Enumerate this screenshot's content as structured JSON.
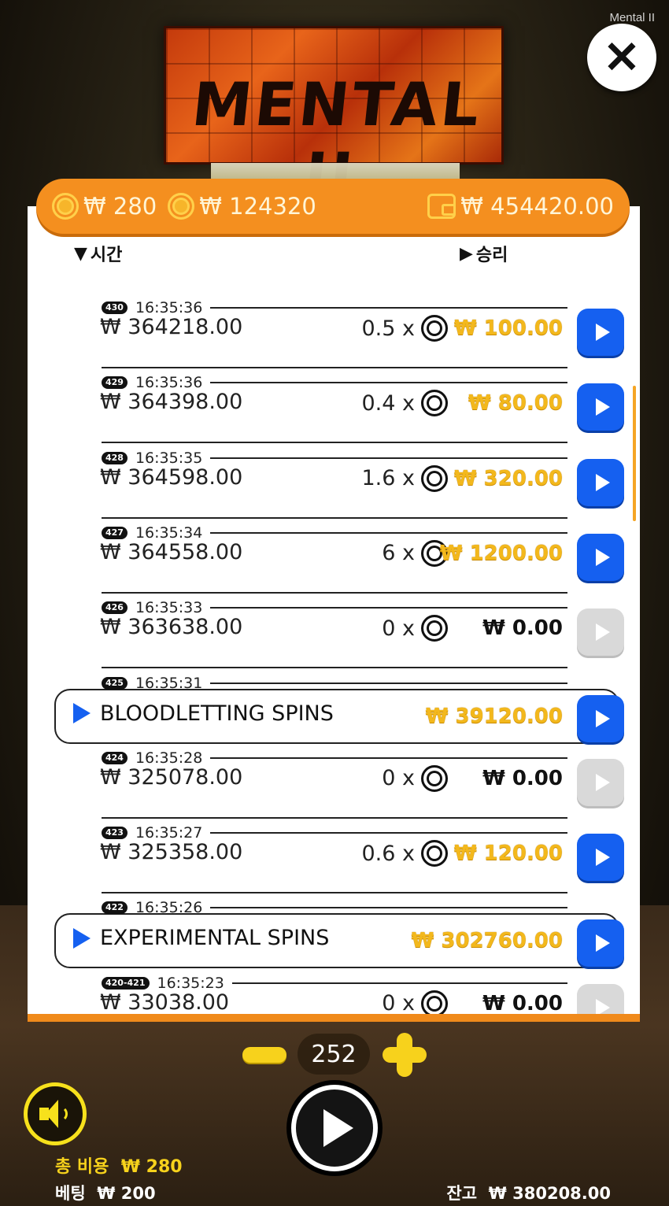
{
  "game_title": "Mental II",
  "logo_text": "MENTAL II",
  "topbar": {
    "stake": "₩ 280",
    "total_win": "₩ 124320",
    "balance": "₩ 454420.00"
  },
  "columns": {
    "time": "시간",
    "win": "승리"
  },
  "rows": [
    {
      "badge": "430",
      "time": "16:35:36",
      "amount": "₩ 364218.00",
      "mult": "0.5 x",
      "win": "₩ 100.00",
      "play_enabled": true
    },
    {
      "badge": "429",
      "time": "16:35:36",
      "amount": "₩ 364398.00",
      "mult": "0.4 x",
      "win": "₩ 80.00",
      "play_enabled": true
    },
    {
      "badge": "428",
      "time": "16:35:35",
      "amount": "₩ 364598.00",
      "mult": "1.6 x",
      "win": "₩ 320.00",
      "play_enabled": true
    },
    {
      "badge": "427",
      "time": "16:35:34",
      "amount": "₩ 364558.00",
      "mult": "6 x",
      "win": "₩ 1200.00",
      "play_enabled": true
    },
    {
      "badge": "426",
      "time": "16:35:33",
      "amount": "₩ 363638.00",
      "mult": "0 x",
      "win": "₩ 0.00",
      "play_enabled": false
    },
    {
      "badge": "425",
      "time": "16:35:31",
      "feature": "BLOODLETTING SPINS",
      "win": "₩ 39120.00",
      "play_enabled": true
    },
    {
      "badge": "424",
      "time": "16:35:28",
      "amount": "₩ 325078.00",
      "mult": "0 x",
      "win": "₩ 0.00",
      "play_enabled": false
    },
    {
      "badge": "423",
      "time": "16:35:27",
      "amount": "₩ 325358.00",
      "mult": "0.6 x",
      "win": "₩ 120.00",
      "play_enabled": true
    },
    {
      "badge": "422",
      "time": "16:35:26",
      "feature": "EXPERIMENTAL SPINS",
      "win": "₩ 302760.00",
      "play_enabled": true
    },
    {
      "badge": "420-421",
      "time": "16:35:23",
      "amount": "₩ 33038.00",
      "mult": "0 x",
      "win": "₩ 0.00",
      "play_enabled": false
    }
  ],
  "controls": {
    "spin_count": "252"
  },
  "footer": {
    "cost_label": "총 비용",
    "cost_value": "₩ 280",
    "bet_label": "베팅",
    "bet_value": "₩ 200",
    "balance_label": "잔고",
    "balance_value": "₩ 380208.00"
  },
  "colors": {
    "accent": "#f48f1f",
    "play": "#1560f0",
    "win": "#f3b81c"
  }
}
